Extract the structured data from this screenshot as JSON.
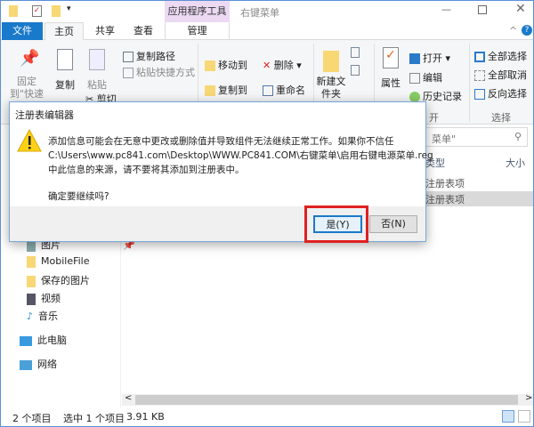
{
  "title_bar": {
    "context_tab": "应用程序工具",
    "window_title": "右键菜单"
  },
  "tabs": {
    "file": "文件",
    "home": "主页",
    "share": "共享",
    "view": "查看",
    "manage": "管理"
  },
  "ribbon": {
    "pin": "固定到\"快速访问\"",
    "copy": "复制",
    "paste": "粘贴",
    "copy_path": "复制路径",
    "paste_shortcut": "粘贴快捷方式",
    "cut": "剪切",
    "move_to": "移动到",
    "copy_to": "复制到",
    "delete": "删除",
    "rename": "重命名",
    "new_folder": "新建文件夹",
    "properties": "属性",
    "open": "打开",
    "edit": "编辑",
    "history": "历史记录",
    "select_all": "全部选择",
    "select_none": "全部取消",
    "invert": "反向选择",
    "group_open": "开",
    "group_select": "选择"
  },
  "content": {
    "search_placeholder": "菜单\"",
    "col_type": "类型",
    "col_size": "大小",
    "rows": [
      "注册表项",
      "注册表项"
    ]
  },
  "nav": {
    "items": [
      "图片",
      "MobileFile",
      "保存的图片",
      "视频",
      "音乐",
      "此电脑",
      "网络"
    ]
  },
  "dialog": {
    "title": "注册表编辑器",
    "line1": "添加信息可能会在无意中更改或删除值并导致组件无法继续正常工作。如果你不信任",
    "line2": "C:\\Users\\www.pc841.com\\Desktop\\WWW.PC841.COM\\右键菜单\\启用右键电源菜单.reg",
    "line3": "中此信息的来源，请不要将其添加到注册表中。",
    "question": "确定要继续吗?",
    "yes": "是(Y)",
    "no": "否(N)"
  },
  "status": {
    "items": "2 个项目",
    "selected": "选中 1 个项目",
    "size": "3.91 KB"
  },
  "colors": {
    "accent": "#1979ca",
    "highlight": "#e02020"
  }
}
